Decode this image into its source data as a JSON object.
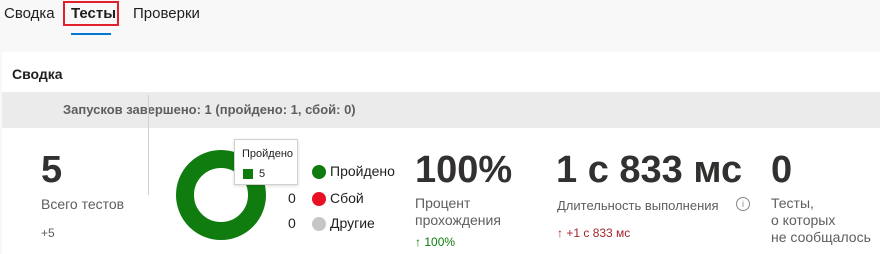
{
  "tabs": [
    {
      "label": "Сводка"
    },
    {
      "label": "Тесты"
    },
    {
      "label": "Проверки"
    }
  ],
  "summary": {
    "title": "Сводка",
    "runs_banner": "Запусков завершено: 1 (пройдено: 1, сбой: 0)",
    "total_tests": {
      "value": "5",
      "label": "Всего тестов",
      "delta": "+5"
    },
    "donut": {
      "legend": [
        {
          "count": "",
          "name": "Пройдено",
          "color": "#107c10"
        },
        {
          "count": "0",
          "name": "Сбой",
          "color": "#e81123"
        },
        {
          "count": "0",
          "name": "Другие",
          "color": "#c8c6c4"
        }
      ],
      "tooltip": {
        "title": "Пройдено",
        "value": "5"
      },
      "passed_fraction": 1.0
    },
    "pass_rate": {
      "value": "100%",
      "label_line1": "Процент",
      "label_line2": "прохождения",
      "delta_arrow": "↑",
      "delta": "100%",
      "delta_color": "#107c10"
    },
    "duration": {
      "value": "1 с 833 мс",
      "label": "Длительность выполнения",
      "info_icon": "i",
      "delta_arrow": "↑",
      "delta": "+1 с 833 мс",
      "delta_color": "#a4262c"
    },
    "unreported": {
      "value": "0",
      "label_line1": "Тесты,",
      "label_line2": "о которых",
      "label_line3": "не сообщалось"
    }
  }
}
